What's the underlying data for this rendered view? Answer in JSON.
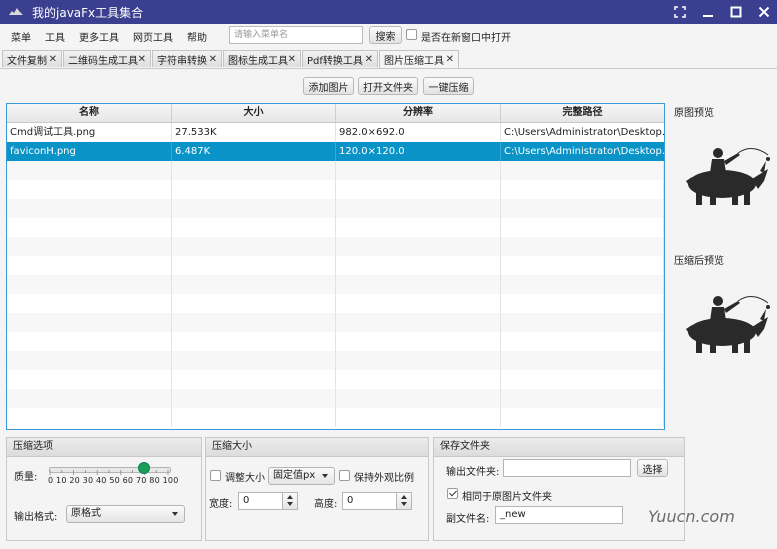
{
  "window": {
    "title": "我的javaFx工具集合",
    "controls": [
      "fullscreen-icon",
      "minimize-icon",
      "maximize-icon",
      "close-icon"
    ]
  },
  "menubar": {
    "items": [
      "菜单",
      "工具",
      "更多工具",
      "网页工具",
      "帮助"
    ],
    "search_placeholder": "请输入菜单名",
    "search_button": "搜索",
    "new_window_label": "是否在新窗口中打开"
  },
  "tabs": [
    {
      "label": "文件复制"
    },
    {
      "label": "二维码生成工具"
    },
    {
      "label": "字符串转换"
    },
    {
      "label": "图标生成工具"
    },
    {
      "label": "Pdf转换工具"
    },
    {
      "label": "图片压缩工具",
      "active": true
    }
  ],
  "toolbar": {
    "add_image": "添加图片",
    "open_folder": "打开文件夹",
    "compress_all": "一键压缩"
  },
  "table": {
    "columns": [
      "名称",
      "大小",
      "分辨率",
      "完整路径"
    ],
    "rows": [
      {
        "name": "Cmd调试工具.png",
        "size": "27.533K",
        "resolution": "982.0×692.0",
        "path": "C:\\Users\\Administrator\\Desktop..."
      },
      {
        "name": "faviconH.png",
        "size": "6.487K",
        "resolution": "120.0×120.0",
        "path": "C:\\Users\\Administrator\\Desktop...",
        "selected": true
      }
    ]
  },
  "preview": {
    "original_label": "原图预览",
    "compressed_label": "压缩后预览"
  },
  "compress_options": {
    "title": "压缩选项",
    "quality_label": "质量:",
    "quality_value": 80,
    "quality_ticks": "0  10 20 30 40 50 60 70 80  100",
    "format_label": "输出格式:",
    "format_value": "原格式"
  },
  "compress_size": {
    "title": "压缩大小",
    "resize_label": "调整大小",
    "mode_value": "固定值px",
    "keep_ratio_label": "保持外观比例",
    "width_label": "宽度:",
    "width_value": "0",
    "height_label": "高度:",
    "height_value": "0"
  },
  "save_folder": {
    "title": "保存文件夹",
    "output_label": "输出文件夹:",
    "output_value": "",
    "choose_button": "选择",
    "same_folder_label": "相同于原图片文件夹",
    "same_folder_checked": true,
    "suffix_label": "副文件名:",
    "suffix_value": "_new"
  },
  "watermark": "Yuucn.com",
  "colors": {
    "titlebar": "#3a3f8f",
    "selection": "#0a93c6",
    "slider_thumb": "#18a05b"
  }
}
